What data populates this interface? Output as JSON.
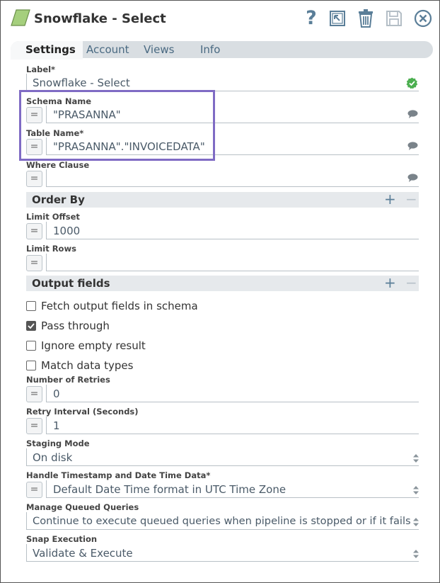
{
  "header": {
    "title": "Snowflake - Select",
    "help_glyph": "?"
  },
  "tabs": [
    {
      "label": "Settings",
      "active": true
    },
    {
      "label": "Account",
      "active": false
    },
    {
      "label": "Views",
      "active": false
    },
    {
      "label": "Info",
      "active": false
    }
  ],
  "fields": {
    "label": {
      "label": "Label*",
      "value": "Snowflake - Select"
    },
    "schema_name": {
      "label": "Schema Name",
      "value": "\"PRASANNA\""
    },
    "table_name": {
      "label": "Table Name*",
      "value": "\"PRASANNA\".\"INVOICEDATA\""
    },
    "where_clause": {
      "label": "Where Clause",
      "value": ""
    },
    "limit_offset": {
      "label": "Limit Offset",
      "value": "1000"
    },
    "limit_rows": {
      "label": "Limit Rows",
      "value": ""
    },
    "number_of_retries": {
      "label": "Number of Retries",
      "value": "0"
    },
    "retry_interval": {
      "label": "Retry Interval (Seconds)",
      "value": "1"
    },
    "staging_mode": {
      "label": "Staging Mode",
      "value": "On disk"
    },
    "handle_timestamp": {
      "label": "Handle Timestamp and Date Time Data*",
      "value": "Default Date Time format in UTC Time Zone"
    },
    "manage_queued": {
      "label": "Manage Queued Queries",
      "value": "Continue to execute queued queries when pipeline is stopped or if it fails"
    },
    "snap_execution": {
      "label": "Snap Execution",
      "value": "Validate & Execute"
    }
  },
  "sections": {
    "order_by": {
      "title": "Order By",
      "add": "+",
      "remove": "−"
    },
    "output_fields": {
      "title": "Output fields",
      "add": "+",
      "remove": "−"
    }
  },
  "checkboxes": [
    {
      "label": "Fetch output fields in schema",
      "checked": false
    },
    {
      "label": "Pass through",
      "checked": true
    },
    {
      "label": "Ignore empty result",
      "checked": false
    },
    {
      "label": "Match data types",
      "checked": false
    }
  ],
  "expression_toggle": "=",
  "colors": {
    "accent": "#5a7e98",
    "valid": "#4caf50",
    "highlight": "#7f6bc4",
    "snap_icon": "#8bc34a"
  },
  "icons": {
    "snap": "snowflake-snap-icon",
    "help": "help-icon",
    "export": "export-icon",
    "delete": "trash-icon",
    "save": "save-icon",
    "close": "close-icon",
    "valid": "check-badge-icon",
    "comment": "comment-bubble-icon"
  }
}
